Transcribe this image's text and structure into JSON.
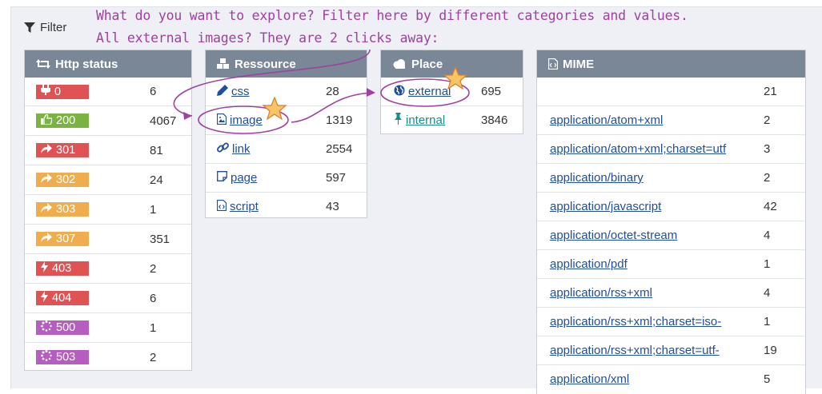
{
  "filter": {
    "label": "Filter"
  },
  "annotation": {
    "line1": "What do you want to explore? Filter here by different categories and values.",
    "line2": "All external images? They are 2 clicks away:"
  },
  "http_status": {
    "title": "Http status",
    "rows": [
      {
        "code": "0",
        "count": "6",
        "color": "#e05355",
        "icon": "plug-icon"
      },
      {
        "code": "200",
        "count": "4067",
        "color": "#7bb342",
        "icon": "thumbs-up-icon"
      },
      {
        "code": "301",
        "count": "81",
        "color": "#e05355",
        "icon": "share-arrow-icon"
      },
      {
        "code": "302",
        "count": "24",
        "color": "#f0ad4e",
        "icon": "share-arrow-icon"
      },
      {
        "code": "303",
        "count": "1",
        "color": "#f0ad4e",
        "icon": "share-arrow-icon"
      },
      {
        "code": "307",
        "count": "351",
        "color": "#f0ad4e",
        "icon": "share-arrow-icon"
      },
      {
        "code": "403",
        "count": "2",
        "color": "#e05355",
        "icon": "bolt-icon"
      },
      {
        "code": "404",
        "count": "6",
        "color": "#e05355",
        "icon": "bolt-icon"
      },
      {
        "code": "500",
        "count": "1",
        "color": "#b65ec0",
        "icon": "spinner-icon"
      },
      {
        "code": "503",
        "count": "2",
        "color": "#b65ec0",
        "icon": "spinner-icon"
      }
    ]
  },
  "ressource": {
    "title": "Ressource",
    "rows": [
      {
        "label": "css",
        "count": "28",
        "icon": "pen-icon"
      },
      {
        "label": "image",
        "count": "1319",
        "icon": "image-file-icon"
      },
      {
        "label": "link",
        "count": "2554",
        "icon": "chain-link-icon"
      },
      {
        "label": "page",
        "count": "597",
        "icon": "page-icon"
      },
      {
        "label": "script",
        "count": "43",
        "icon": "code-file-icon"
      }
    ]
  },
  "place": {
    "title": "Place",
    "rows": [
      {
        "label": "external",
        "count": "695",
        "icon": "globe-icon"
      },
      {
        "label": "internal",
        "count": "3846",
        "icon": "pin-icon"
      }
    ]
  },
  "mime": {
    "title": "MIME",
    "rows": [
      {
        "label": "",
        "count": "21"
      },
      {
        "label": "application/atom+xml",
        "count": "2"
      },
      {
        "label": "application/atom+xml;charset=utf",
        "count": "3"
      },
      {
        "label": "application/binary",
        "count": "2"
      },
      {
        "label": "application/javascript",
        "count": "42"
      },
      {
        "label": "application/octet-stream",
        "count": "4"
      },
      {
        "label": "application/pdf",
        "count": "1"
      },
      {
        "label": "application/rss+xml",
        "count": "4"
      },
      {
        "label": "application/rss+xml;charset=iso-",
        "count": "1"
      },
      {
        "label": "application/rss+xml;charset=utf-",
        "count": "19"
      },
      {
        "label": "application/xml",
        "count": "5"
      }
    ]
  },
  "colors": {
    "header_bg": "#7a8797",
    "link": "#1f4e9a",
    "place_link": "#1a8a8a",
    "annotation": "#a040a0",
    "star": "#f7c566"
  }
}
